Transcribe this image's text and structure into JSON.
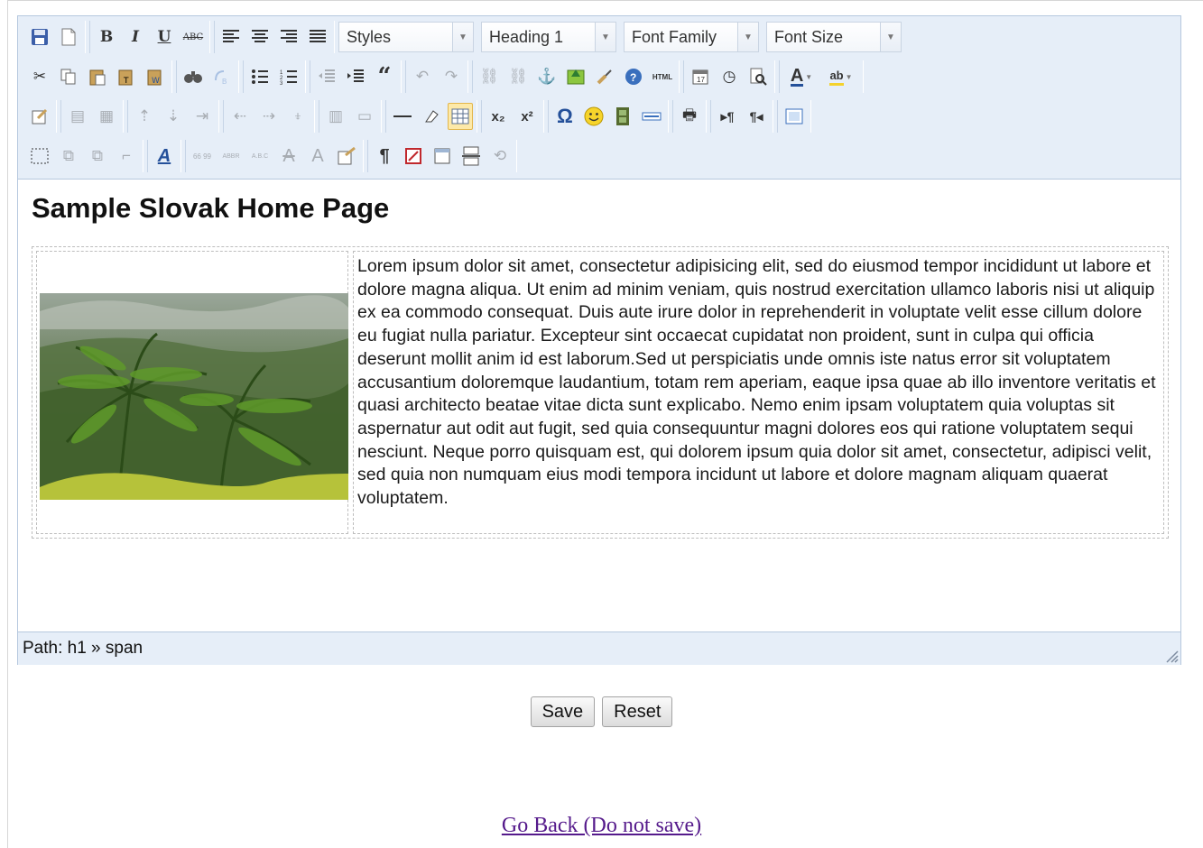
{
  "toolbar": {
    "styles_select": "Styles",
    "format_select": "Heading 1",
    "font_family_select": "Font Family",
    "font_size_select": "Font Size",
    "bold": "B",
    "italic": "I",
    "underline": "U",
    "strike": "ABC",
    "html": "HTML",
    "abbr": "ABBR",
    "acronym": "A.B.C",
    "quote": "66 99",
    "pilcrow": "¶",
    "omega": "Ω",
    "blockquote": "“",
    "sub": "x₂",
    "sup": "x²",
    "font_color_a": "A",
    "highlight": "ab"
  },
  "content": {
    "heading": "Sample Slovak Home Page",
    "paragraph": "Lorem ipsum dolor sit amet, consectetur adipisicing elit, sed do eiusmod tempor incididunt ut labore et dolore magna aliqua. Ut enim ad minim veniam, quis nostrud exercitation ullamco laboris nisi ut aliquip ex ea commodo consequat. Duis aute irure dolor in reprehenderit in voluptate velit esse cillum dolore eu fugiat nulla pariatur. Excepteur sint occaecat cupidatat non proident, sunt in culpa qui officia deserunt mollit anim id est laborum.Sed ut perspiciatis unde omnis iste natus error sit voluptatem accusantium doloremque laudantium, totam rem aperiam, eaque ipsa quae ab illo inventore veritatis et quasi architecto beatae vitae dicta sunt explicabo. Nemo enim ipsam voluptatem quia voluptas sit aspernatur aut odit aut fugit, sed quia consequuntur magni dolores eos qui ratione voluptatem sequi nesciunt. Neque porro quisquam est, qui dolorem ipsum quia dolor sit amet, consectetur, adipisci velit, sed quia non numquam eius modi tempora incidunt ut labore et dolore magnam aliquam quaerat voluptatem."
  },
  "statusbar": {
    "path": "Path: h1 » span"
  },
  "actions": {
    "save": "Save",
    "reset": "Reset",
    "back": "Go Back (Do not save)"
  },
  "colors": {
    "toolbar_bg": "#e6eef8",
    "border": "#b6c8de",
    "link": "#551a8b"
  }
}
